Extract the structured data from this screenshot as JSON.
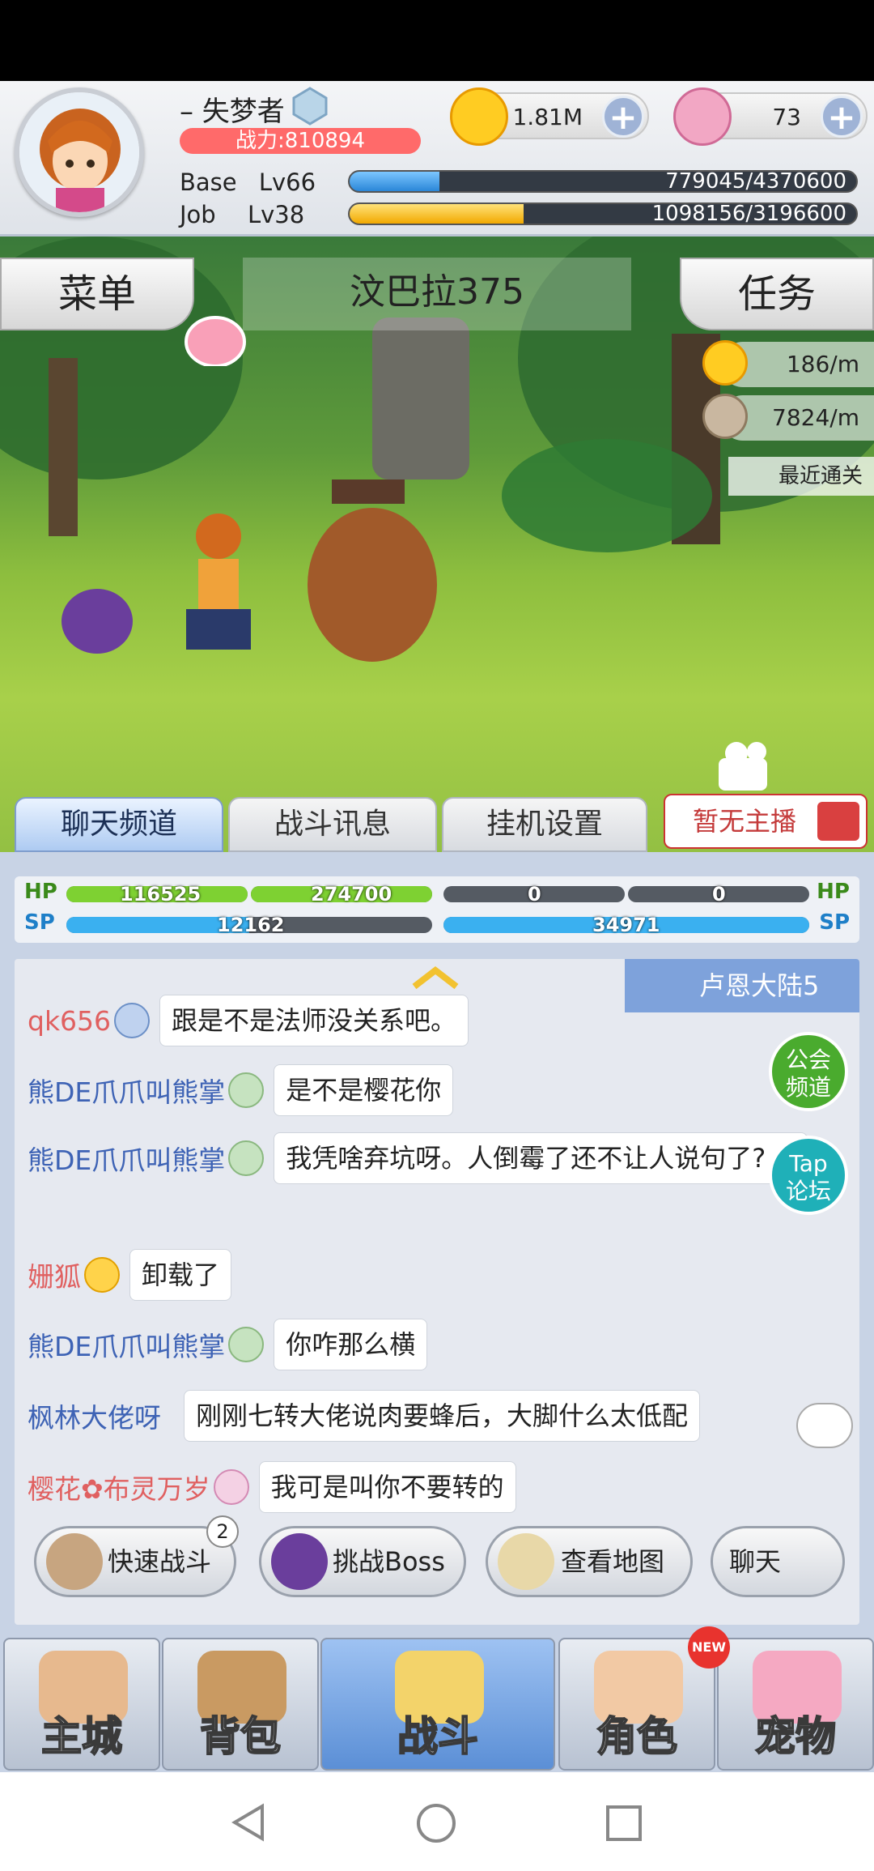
{
  "player": {
    "name": "– 失梦者",
    "power": "战力:810894",
    "gold": "1.81M",
    "gems": "73",
    "base_label": "Base",
    "base_level": "Lv66",
    "base_exp": "779045/4370600",
    "base_progress": 0.178,
    "job_label": "Job",
    "job_level": "Lv38",
    "job_exp": "1098156/3196600",
    "job_progress": 0.343
  },
  "scene": {
    "menu_label": "菜单",
    "quest_label": "任务",
    "map_name": "汶巴拉375",
    "gold_rate": "186/m",
    "exp_rate": "7824/m",
    "recent_clear": "最近通关"
  },
  "tabs": [
    "聊天频道",
    "战斗讯息",
    "挂机设置"
  ],
  "live_label": "暂无主播",
  "vitals": {
    "hp_label": "HP",
    "sp_label": "SP",
    "p1_hp": "116525",
    "p2_hp": "274700",
    "p3_hp": "0",
    "p4_hp": "0",
    "p1_sp": "12162",
    "p3_sp": "34971"
  },
  "chat": {
    "region": "卢恩大陆5",
    "guild_btn": "公会频道",
    "tap_btn": "Tap论坛",
    "messages": [
      {
        "user": "qk656",
        "text": "跟是不是法师没关系吧。"
      },
      {
        "user": "熊DE爪爪叫熊掌",
        "text": "是不是樱花你"
      },
      {
        "user": "熊DE爪爪叫熊掌",
        "text": "我凭啥弃坑呀。人倒霉了还不让人说句了?"
      },
      {
        "user": "姗狐",
        "text": "卸载了"
      },
      {
        "user": "熊DE爪爪叫熊掌",
        "text": "你咋那么横"
      },
      {
        "user": "枫林大佬呀",
        "text": "刚刚七转大佬说肉要蜂后，大脚什么太低配"
      },
      {
        "user": "樱花✿布灵万岁",
        "text": "我可是叫你不要转的"
      }
    ]
  },
  "actions": {
    "quick_battle": "快速战斗",
    "quick_battle_count": "2",
    "boss": "挑战Boss",
    "map": "查看地图",
    "chat": "聊天"
  },
  "nav": [
    "主城",
    "背包",
    "战斗",
    "角色",
    "宠物"
  ],
  "nav_badge": "NEW"
}
